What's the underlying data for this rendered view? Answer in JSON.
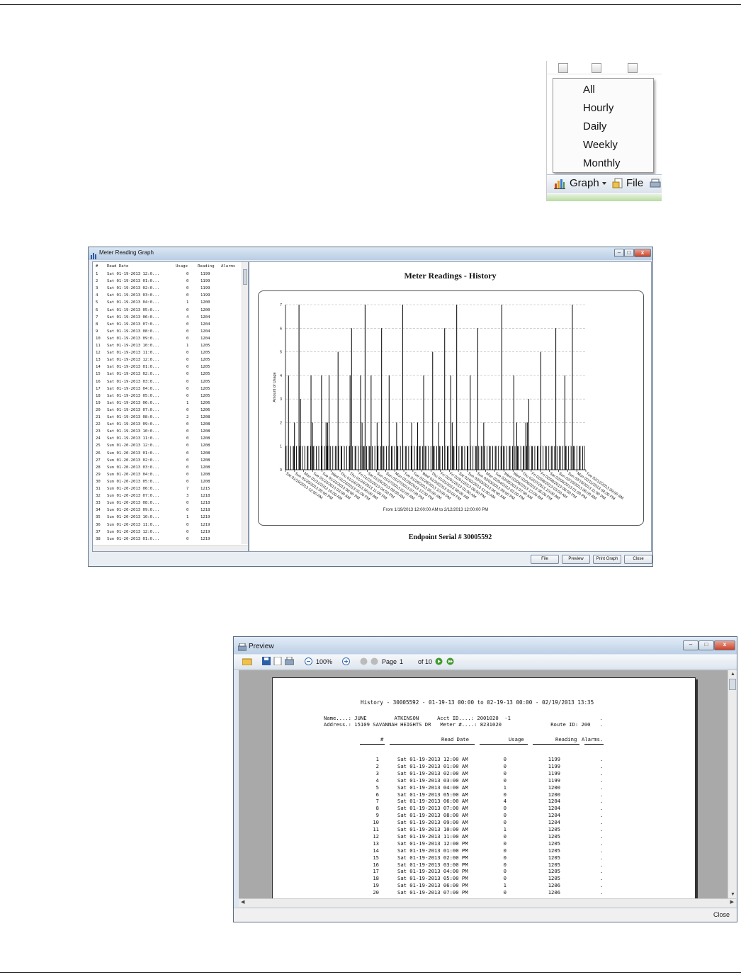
{
  "menu": {
    "items": [
      "All",
      "Hourly",
      "Daily",
      "Weekly",
      "Monthly"
    ],
    "toolbar": {
      "graph_label": "Graph",
      "file_label": "File"
    }
  },
  "graph_window": {
    "title": "Meter Reading Graph",
    "columns": [
      "#",
      "Read Date",
      "Usage",
      "Reading",
      "Alarms"
    ],
    "rows": [
      [
        "1",
        "Sat 01-19-2013 12:0...",
        "0",
        "1199"
      ],
      [
        "2",
        "Sat 01-19-2013 01:0...",
        "0",
        "1199"
      ],
      [
        "3",
        "Sat 01-19-2013 02:0...",
        "0",
        "1199"
      ],
      [
        "4",
        "Sat 01-19-2013 03:0...",
        "0",
        "1199"
      ],
      [
        "5",
        "Sat 01-19-2013 04:0...",
        "1",
        "1200"
      ],
      [
        "6",
        "Sat 01-19-2013 05:0...",
        "0",
        "1200"
      ],
      [
        "7",
        "Sat 01-19-2013 06:0...",
        "4",
        "1204"
      ],
      [
        "8",
        "Sat 01-19-2013 07:0...",
        "0",
        "1204"
      ],
      [
        "9",
        "Sat 01-19-2013 08:0...",
        "0",
        "1204"
      ],
      [
        "10",
        "Sat 01-19-2013 09:0...",
        "0",
        "1204"
      ],
      [
        "11",
        "Sat 01-19-2013 10:0...",
        "1",
        "1205"
      ],
      [
        "12",
        "Sat 01-19-2013 11:0...",
        "0",
        "1205"
      ],
      [
        "13",
        "Sat 01-19-2013 12:0...",
        "0",
        "1205"
      ],
      [
        "14",
        "Sat 01-19-2013 01:0...",
        "0",
        "1205"
      ],
      [
        "15",
        "Sat 01-19-2013 02:0...",
        "0",
        "1205"
      ],
      [
        "16",
        "Sat 01-19-2013 03:0...",
        "0",
        "1205"
      ],
      [
        "17",
        "Sat 01-19-2013 04:0...",
        "0",
        "1205"
      ],
      [
        "18",
        "Sat 01-19-2013 05:0...",
        "0",
        "1205"
      ],
      [
        "19",
        "Sat 01-19-2013 06:0...",
        "1",
        "1206"
      ],
      [
        "20",
        "Sat 01-19-2013 07:0...",
        "0",
        "1206"
      ],
      [
        "21",
        "Sat 01-19-2013 08:0...",
        "2",
        "1208"
      ],
      [
        "22",
        "Sat 01-19-2013 09:0...",
        "0",
        "1208"
      ],
      [
        "23",
        "Sat 01-19-2013 10:0...",
        "0",
        "1208"
      ],
      [
        "24",
        "Sat 01-19-2013 11:0...",
        "0",
        "1208"
      ],
      [
        "25",
        "Sun 01-20-2013 12:0...",
        "0",
        "1208"
      ],
      [
        "26",
        "Sun 01-20-2013 01:0...",
        "0",
        "1208"
      ],
      [
        "27",
        "Sun 01-20-2013 02:0...",
        "0",
        "1208"
      ],
      [
        "28",
        "Sun 01-20-2013 03:0...",
        "0",
        "1208"
      ],
      [
        "29",
        "Sun 01-20-2013 04:0...",
        "0",
        "1208"
      ],
      [
        "30",
        "Sun 01-20-2013 05:0...",
        "0",
        "1208"
      ],
      [
        "31",
        "Sun 01-20-2013 06:0...",
        "7",
        "1215"
      ],
      [
        "32",
        "Sun 01-20-2013 07:0...",
        "3",
        "1218"
      ],
      [
        "33",
        "Sun 01-20-2013 08:0...",
        "0",
        "1218"
      ],
      [
        "34",
        "Sun 01-20-2013 09:0...",
        "0",
        "1218"
      ],
      [
        "35",
        "Sun 01-20-2013 10:0...",
        "1",
        "1219"
      ],
      [
        "36",
        "Sun 01-20-2013 11:0...",
        "0",
        "1219"
      ],
      [
        "37",
        "Sun 01-20-2013 12:0...",
        "0",
        "1219"
      ],
      [
        "38",
        "Sun 01-20-2013 01:0...",
        "0",
        "1219"
      ]
    ],
    "chart_title": "Meter Readings - History",
    "footer_serial": "Endpoint Serial # 30005592",
    "buttons": {
      "file": "File",
      "preview": "Preview",
      "print_graph": "Print Graph",
      "close": "Close"
    }
  },
  "chart_data": {
    "type": "bar",
    "title": "Meter Readings - History",
    "ylabel": "Amount of Usage",
    "xlabel": "From 1/19/2013 12:00:00 AM to 2/12/2013 12:00:00 PM",
    "ylim": [
      0,
      7
    ],
    "y_ticks": [
      0,
      1,
      2,
      3,
      4,
      5,
      6,
      7
    ],
    "x_tick_labels": [
      "Sat 01/19/2013 12:00 AM",
      "Sun 01/20/2013 05:00 PM",
      "Mon 01/21/2013 10:00 AM",
      "Tue 01/22/2013 03:00 AM",
      "Tue 01/22/2013 08:00 PM",
      "Wed 01/23/2013 01:00 PM",
      "Thu 01/24/2013 06:00 AM",
      "Thu 01/24/2013 11:00 PM",
      "Fri 01/25/2013 04:00 PM",
      "Sat 01/26/2013 09:00 AM",
      "Sun 01/27/2013 02:00 AM",
      "Sun 01/27/2013 07:00 PM",
      "Mon 01/28/2013 12:00 PM",
      "Tue 01/29/2013 05:00 AM",
      "Tue 01/29/2013 10:00 PM",
      "Wed 01/30/2013 03:00 PM",
      "Thu 01/31/2013 08:00 AM",
      "Fri 02/01/2013 01:00 AM",
      "Fri 02/01/2013 06:00 PM",
      "Sat 02/02/2013 11:00 AM",
      "Sun 02/03/2013 04:00 AM",
      "Sun 02/03/2013 09:00 PM",
      "Mon 02/04/2013 02:00 PM",
      "Tue 02/05/2013 07:00 AM",
      "Wed 02/06/2013 12:00 AM",
      "Wed 02/06/2013 05:00 PM",
      "Thu 02/07/2013 10:00 AM",
      "Fri 02/08/2013 03:00 AM",
      "Fri 02/08/2013 08:00 PM",
      "Sat 02/09/2013 01:00 PM",
      "Sun 02/10/2013 06:00 AM",
      "Sun 02/10/2013 11:00 PM",
      "Mon 02/11/2013 04:00 PM",
      "Tue 02/12/2013 09:00 AM"
    ],
    "peaks": [
      {
        "pos": 0.01,
        "value": 4
      },
      {
        "pos": 0.03,
        "value": 2
      },
      {
        "pos": 0.045,
        "value": 7
      },
      {
        "pos": 0.05,
        "value": 3
      },
      {
        "pos": 0.085,
        "value": 4
      },
      {
        "pos": 0.09,
        "value": 2
      },
      {
        "pos": 0.12,
        "value": 4
      },
      {
        "pos": 0.135,
        "value": 2
      },
      {
        "pos": 0.14,
        "value": 2
      },
      {
        "pos": 0.145,
        "value": 4
      },
      {
        "pos": 0.175,
        "value": 5
      },
      {
        "pos": 0.215,
        "value": 4
      },
      {
        "pos": 0.22,
        "value": 6
      },
      {
        "pos": 0.25,
        "value": 4
      },
      {
        "pos": 0.255,
        "value": 2
      },
      {
        "pos": 0.265,
        "value": 7
      },
      {
        "pos": 0.285,
        "value": 4
      },
      {
        "pos": 0.305,
        "value": 2
      },
      {
        "pos": 0.32,
        "value": 6
      },
      {
        "pos": 0.345,
        "value": 4
      },
      {
        "pos": 0.37,
        "value": 2
      },
      {
        "pos": 0.39,
        "value": 7
      },
      {
        "pos": 0.42,
        "value": 2
      },
      {
        "pos": 0.44,
        "value": 2
      },
      {
        "pos": 0.46,
        "value": 4
      },
      {
        "pos": 0.49,
        "value": 5
      },
      {
        "pos": 0.51,
        "value": 2
      },
      {
        "pos": 0.53,
        "value": 6
      },
      {
        "pos": 0.55,
        "value": 4
      },
      {
        "pos": 0.555,
        "value": 2
      },
      {
        "pos": 0.57,
        "value": 7
      },
      {
        "pos": 0.615,
        "value": 4
      },
      {
        "pos": 0.64,
        "value": 6
      },
      {
        "pos": 0.66,
        "value": 2
      },
      {
        "pos": 0.72,
        "value": 7
      },
      {
        "pos": 0.76,
        "value": 4
      },
      {
        "pos": 0.77,
        "value": 2
      },
      {
        "pos": 0.8,
        "value": 2
      },
      {
        "pos": 0.805,
        "value": 2
      },
      {
        "pos": 0.81,
        "value": 3
      },
      {
        "pos": 0.85,
        "value": 5
      },
      {
        "pos": 0.9,
        "value": 6
      },
      {
        "pos": 0.93,
        "value": 4
      },
      {
        "pos": 0.955,
        "value": 7
      }
    ],
    "baseline_value": 1,
    "grid": true,
    "colors": {
      "bars": "#000000",
      "grid": "#b5b5b5"
    }
  },
  "preview_window": {
    "title": "Preview",
    "toolbar": {
      "zoom": "100%",
      "page_label": "Page",
      "page_value": "1",
      "of_label": "of 10"
    },
    "report": {
      "header": "History - 30005592 - 01-19-13 00:00 to 02-19-13 00:00 - 02/19/2013 13:35",
      "name_line": "Name....: JUNE         ATKINSON      Acct ID....: 2001020  -1                             .",
      "address_line": "Address.: 15109 SAVANNAH HEIGHTS DR   Meter #....: 8231020                Route ID: 200   .",
      "columns": [
        "#",
        "Read Date",
        "Usage",
        "Reading",
        "Alarms."
      ],
      "rows": [
        [
          "1",
          "Sat 01-19-2013 12:00 AM",
          "0",
          "1199",
          "."
        ],
        [
          "2",
          "Sat 01-19-2013 01:00 AM",
          "0",
          "1199",
          "."
        ],
        [
          "3",
          "Sat 01-19-2013 02:00 AM",
          "0",
          "1199",
          "."
        ],
        [
          "4",
          "Sat 01-19-2013 03:00 AM",
          "0",
          "1199",
          "."
        ],
        [
          "5",
          "Sat 01-19-2013 04:00 AM",
          "1",
          "1200",
          "."
        ],
        [
          "6",
          "Sat 01-19-2013 05:00 AM",
          "0",
          "1200",
          "."
        ],
        [
          "7",
          "Sat 01-19-2013 06:00 AM",
          "4",
          "1204",
          "."
        ],
        [
          "8",
          "Sat 01-19-2013 07:00 AM",
          "0",
          "1204",
          "."
        ],
        [
          "9",
          "Sat 01-19-2013 08:00 AM",
          "0",
          "1204",
          "."
        ],
        [
          "10",
          "Sat 01-19-2013 09:00 AM",
          "0",
          "1204",
          "."
        ],
        [
          "11",
          "Sat 01-19-2013 10:00 AM",
          "1",
          "1205",
          "."
        ],
        [
          "12",
          "Sat 01-19-2013 11:00 AM",
          "0",
          "1205",
          "."
        ],
        [
          "13",
          "Sat 01-19-2013 12:00 PM",
          "0",
          "1205",
          "."
        ],
        [
          "14",
          "Sat 01-19-2013 01:00 PM",
          "0",
          "1205",
          "."
        ],
        [
          "15",
          "Sat 01-19-2013 02:00 PM",
          "0",
          "1205",
          "."
        ],
        [
          "16",
          "Sat 01-19-2013 03:00 PM",
          "0",
          "1205",
          "."
        ],
        [
          "17",
          "Sat 01-19-2013 04:00 PM",
          "0",
          "1205",
          "."
        ],
        [
          "18",
          "Sat 01-19-2013 05:00 PM",
          "0",
          "1205",
          "."
        ],
        [
          "19",
          "Sat 01-19-2013 06:00 PM",
          "1",
          "1206",
          "."
        ],
        [
          "20",
          "Sat 01-19-2013 07:00 PM",
          "0",
          "1206",
          "."
        ]
      ]
    },
    "status": {
      "close": "Close"
    }
  }
}
